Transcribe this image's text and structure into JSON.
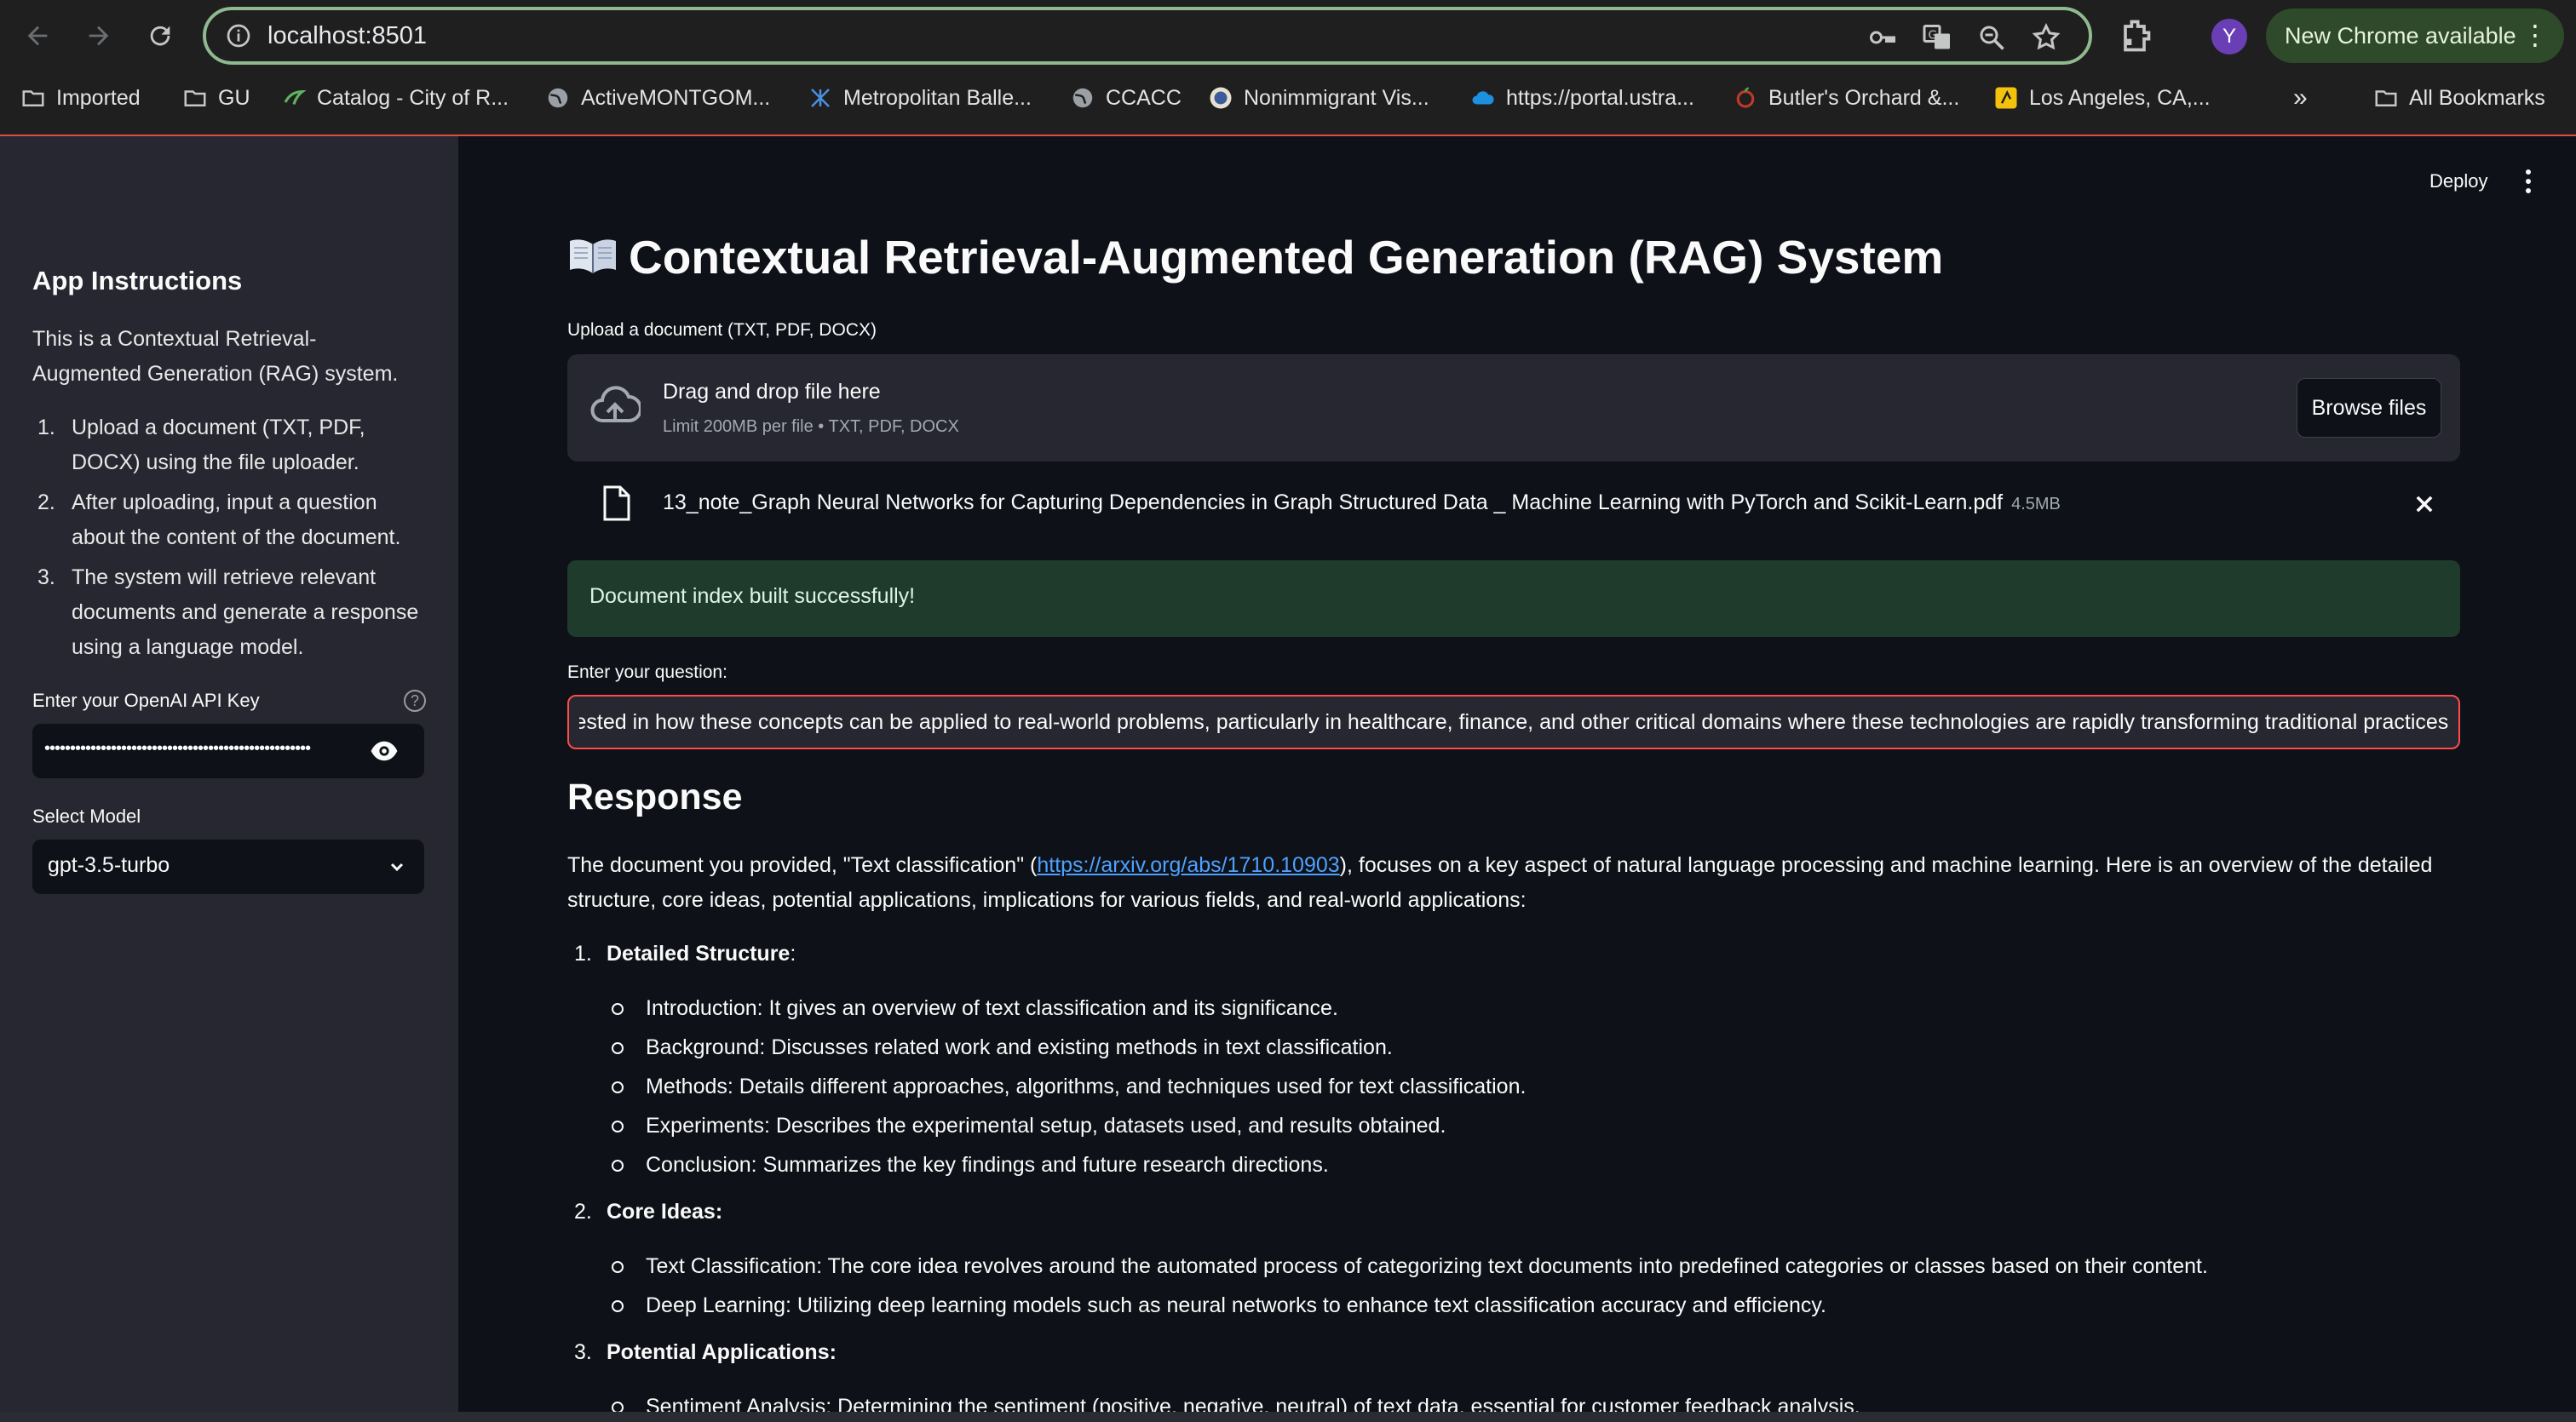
{
  "browser": {
    "url": "localhost:8501",
    "profile_initial": "Y",
    "update_label": "New Chrome available",
    "bookmarks": [
      {
        "label": "Imported",
        "icon": "folder-icon"
      },
      {
        "label": "GU",
        "icon": "folder-icon"
      },
      {
        "label": "Catalog - City of R...",
        "icon": "catalog-icon"
      },
      {
        "label": "ActiveMONTGOM...",
        "icon": "globe-icon"
      },
      {
        "label": "Metropolitan Balle...",
        "icon": "ballet-icon"
      },
      {
        "label": "CCACC",
        "icon": "globe-icon"
      },
      {
        "label": "Nonimmigrant Vis...",
        "icon": "seal-icon"
      },
      {
        "label": "https://portal.ustra...",
        "icon": "cloud-icon"
      },
      {
        "label": "Butler's Orchard &...",
        "icon": "orchard-icon"
      },
      {
        "label": "Los Angeles, CA,...",
        "icon": "map-icon"
      }
    ],
    "overflow_label": "»",
    "all_bookmarks_label": "All Bookmarks"
  },
  "sidebar": {
    "title": "App Instructions",
    "description": "This is a Contextual Retrieval-Augmented Generation (RAG) system.",
    "steps": [
      {
        "num": "1.",
        "text": "Upload a document (TXT, PDF, DOCX) using the file uploader."
      },
      {
        "num": "2.",
        "text": "After uploading, input a question about the content of the document."
      },
      {
        "num": "3.",
        "text": "The system will retrieve relevant documents and generate a response using a language model."
      }
    ],
    "api_key_label": "Enter your OpenAI API Key",
    "api_key_value": "••••••••••••••••••••••••••••••••••••••••••••••••••••",
    "model_label": "Select Model",
    "model_value": "gpt-3.5-turbo"
  },
  "header": {
    "deploy_label": "Deploy"
  },
  "main": {
    "title": "Contextual Retrieval-Augmented Generation (RAG) System",
    "upload_label": "Upload a document (TXT, PDF, DOCX)",
    "drop_text": "Drag and drop file here",
    "limit_text": "Limit 200MB per file • TXT, PDF, DOCX",
    "browse_label": "Browse files",
    "file_name": "13_note_Graph Neural Networks for Capturing Dependencies in Graph Structured Data _ Machine Learning with PyTorch and Scikit-Learn.pdf",
    "file_size": "4.5MB",
    "success_message": "Document index built successfully!",
    "question_label": "Enter your question:",
    "question_value": "o interested in how these concepts can be applied to real-world problems, particularly in healthcare, finance, and other critical domains where these technologies are rapidly transforming traditional practices",
    "response_heading": "Response",
    "response_intro_before": "The document you provided, \"Text classification\" (",
    "response_link": "https://arxiv.org/abs/1710.10903",
    "response_intro_after": "), focuses on a key aspect of natural language processing and machine learning. Here is an overview of the detailed structure, core ideas, potential applications, implications for various fields, and real-world applications:",
    "sections": [
      {
        "num": "1.",
        "title": "Detailed Structure",
        "suffix": ":",
        "items": [
          "Introduction: It gives an overview of text classification and its significance.",
          "Background: Discusses related work and existing methods in text classification.",
          "Methods: Details different approaches, algorithms, and techniques used for text classification.",
          "Experiments: Describes the experimental setup, datasets used, and results obtained.",
          "Conclusion: Summarizes the key findings and future research directions."
        ]
      },
      {
        "num": "2.",
        "title": "Core Ideas:",
        "suffix": "",
        "items": [
          "Text Classification: The core idea revolves around the automated process of categorizing text documents into predefined categories or classes based on their content.",
          "Deep Learning: Utilizing deep learning models such as neural networks to enhance text classification accuracy and efficiency."
        ]
      },
      {
        "num": "3.",
        "title": "Potential Applications:",
        "suffix": "",
        "items": [
          "Sentiment Analysis: Determining the sentiment (positive, negative, neutral) of text data, essential for customer feedback analysis."
        ]
      }
    ]
  },
  "colors": {
    "sidebar_bg": "#262730",
    "main_bg": "#0e1117",
    "accent_error": "#ff4b4b",
    "success_bg": "#1f3b2b",
    "link": "#4ea1ff"
  }
}
